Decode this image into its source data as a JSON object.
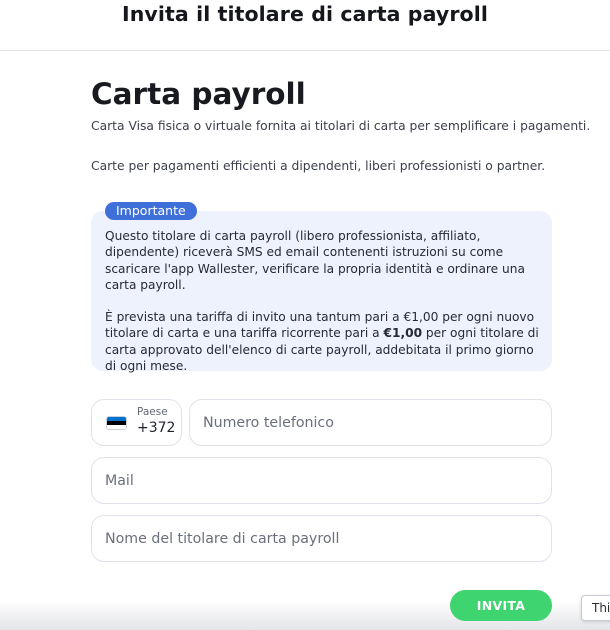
{
  "header": {
    "title": "Invita il titolare di carta payroll"
  },
  "main": {
    "title": "Carta payroll",
    "subtitle": "Carta Visa fisica o virtuale fornita ai titolari di carta per semplificare i pagamenti.",
    "description": "Carte per pagamenti efficienti a dipendenti, liberi professionisti o partner."
  },
  "notice": {
    "badge": "Importante",
    "paragraph1": "Questo titolare di carta payroll (libero professionista, affiliato, dipendente) riceverà SMS ed email contenenti istruzioni su come scaricare l'app Wallester, verificare la propria identità e ordinare una carta payroll.",
    "paragraph2_before": "È prevista una tariffa di invito una tantum pari a €1,00 per ogni nuovo titolare di carta e una tariffa ricorrente pari a ",
    "paragraph2_bold": "€1,00",
    "paragraph2_after": " per ogni titolare di carta approvato dell'elenco di carte payroll, addebitata il primo giorno di ogni mese."
  },
  "form": {
    "country_label": "Paese",
    "country_code": "+372",
    "flag_colors": [
      "#0072ce",
      "#000000",
      "#ffffff"
    ],
    "phone_placeholder": "Numero telefonico",
    "mail_placeholder": "Mail",
    "holder_placeholder": "Nome del titolare di carta payroll",
    "invite_label": "INVITA"
  },
  "overlay": {
    "chip_label": "Thi"
  },
  "colors": {
    "accent_blue": "#3f6fd8",
    "notice_bg": "#edf2fd",
    "invite_green": "#3ed46f"
  }
}
